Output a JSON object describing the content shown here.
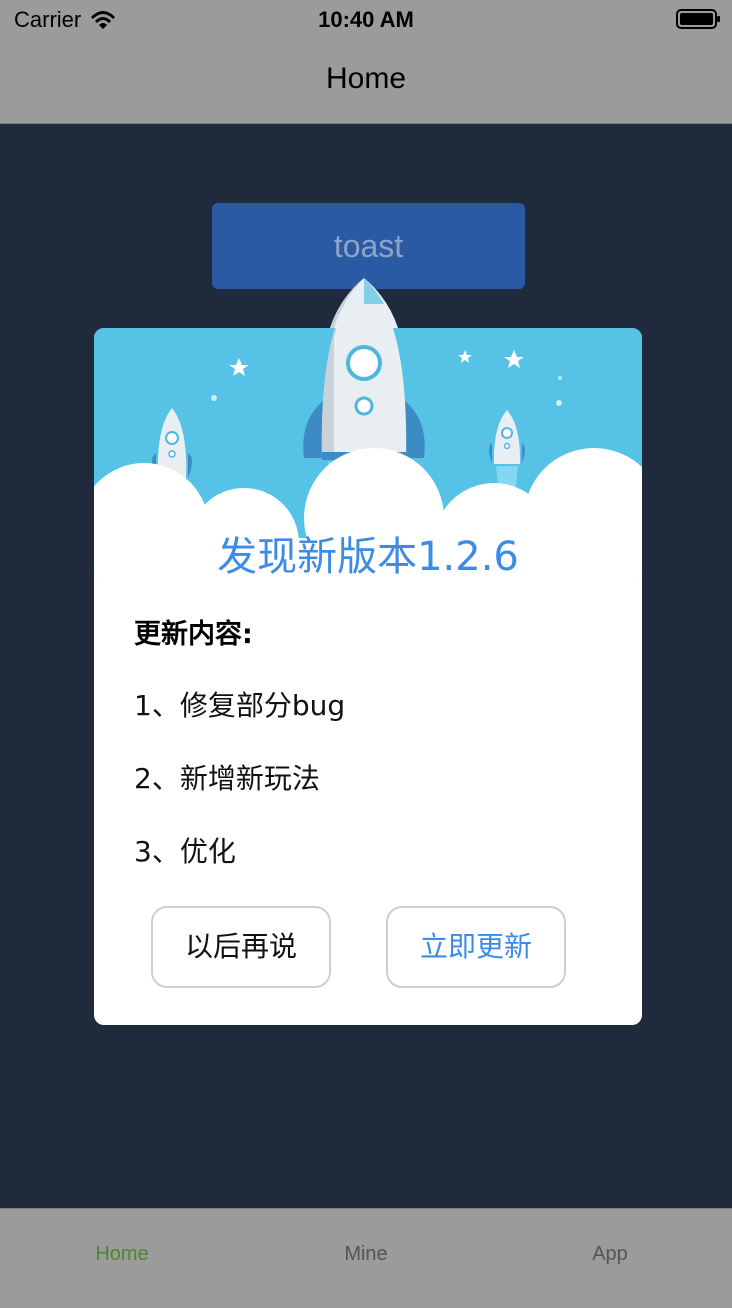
{
  "status_bar": {
    "carrier": "Carrier",
    "time": "10:40 AM",
    "icons": [
      "wifi-icon",
      "battery-icon"
    ]
  },
  "nav": {
    "title": "Home"
  },
  "toast_button": {
    "label": "toast"
  },
  "dialog": {
    "title": "发现新版本1.2.6",
    "changelog_heading": "更新内容:",
    "changelog_items": [
      "1、修复部分bug",
      "2、新增新玩法",
      "3、优化"
    ],
    "later_label": "以后再说",
    "update_label": "立即更新",
    "accent_color": "#3c8ce7",
    "header_color": "#56c2e6"
  },
  "tab_bar": {
    "tabs": [
      {
        "label": "Home",
        "active": true
      },
      {
        "label": "Mine",
        "active": false
      },
      {
        "label": "App",
        "active": false
      }
    ],
    "active_color": "#4a8a2a"
  },
  "colors": {
    "background": "#1f2a3c",
    "bars": "#9b9b9b",
    "toast": "#2b5aa4"
  }
}
